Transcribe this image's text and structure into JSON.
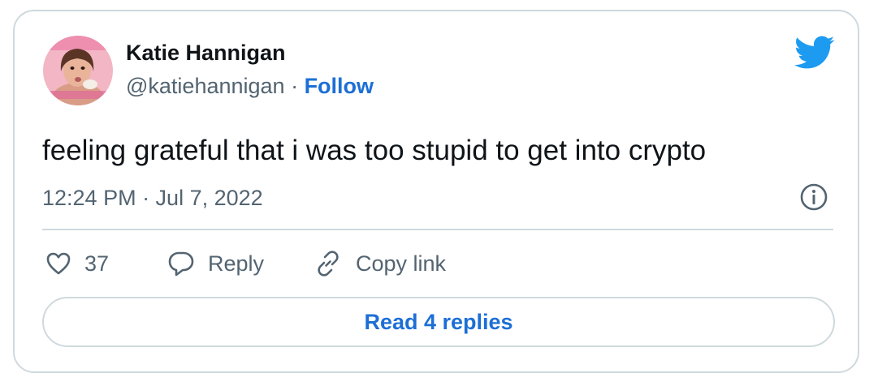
{
  "tweet": {
    "author_name": "Katie Hannigan",
    "handle": "@katiehannigan",
    "separator": " · ",
    "follow_label": "Follow",
    "text": "feeling grateful that i was too stupid to get into crypto",
    "timestamp": "12:24 PM · Jul 7, 2022"
  },
  "actions": {
    "like_count": "37",
    "reply_label": "Reply",
    "copy_link_label": "Copy link"
  },
  "read_replies_label": "Read 4 replies",
  "colors": {
    "link_blue": "#1d6fd6",
    "twitter_blue": "#1d9bf0",
    "text_dark": "#0f1419",
    "text_gray": "#536471",
    "border": "#cfd9de"
  },
  "icons": [
    "profile-avatar",
    "twitter-bird-icon",
    "info-icon",
    "heart-icon",
    "reply-bubble-icon",
    "link-icon"
  ]
}
